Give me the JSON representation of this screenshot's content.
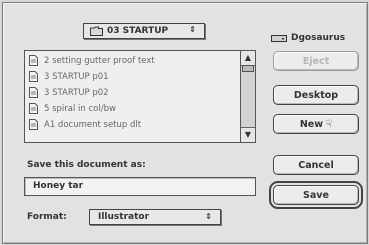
{
  "folder_popup": {
    "label": "03 STARTUP",
    "arrows": "⇕"
  },
  "disk": {
    "label": "Dgosaurus"
  },
  "files": [
    {
      "name": "2 setting gutter proof text"
    },
    {
      "name": "3 STARTUP p01"
    },
    {
      "name": "3 STARTUP p02"
    },
    {
      "name": "5 spiral in col/bw"
    },
    {
      "name": "A1 document setup dlt"
    }
  ],
  "scroll": {
    "up": "▲",
    "down": "▼"
  },
  "buttons": {
    "eject": "Eject",
    "desktop": "Desktop",
    "new": "New",
    "cancel": "Cancel",
    "save": "Save",
    "cursor": "☟"
  },
  "save_as_label": "Save this document as:",
  "document_name": "Honey tar",
  "format": {
    "label": "Format:",
    "value": "Illustrator",
    "arrows": "⇕"
  }
}
